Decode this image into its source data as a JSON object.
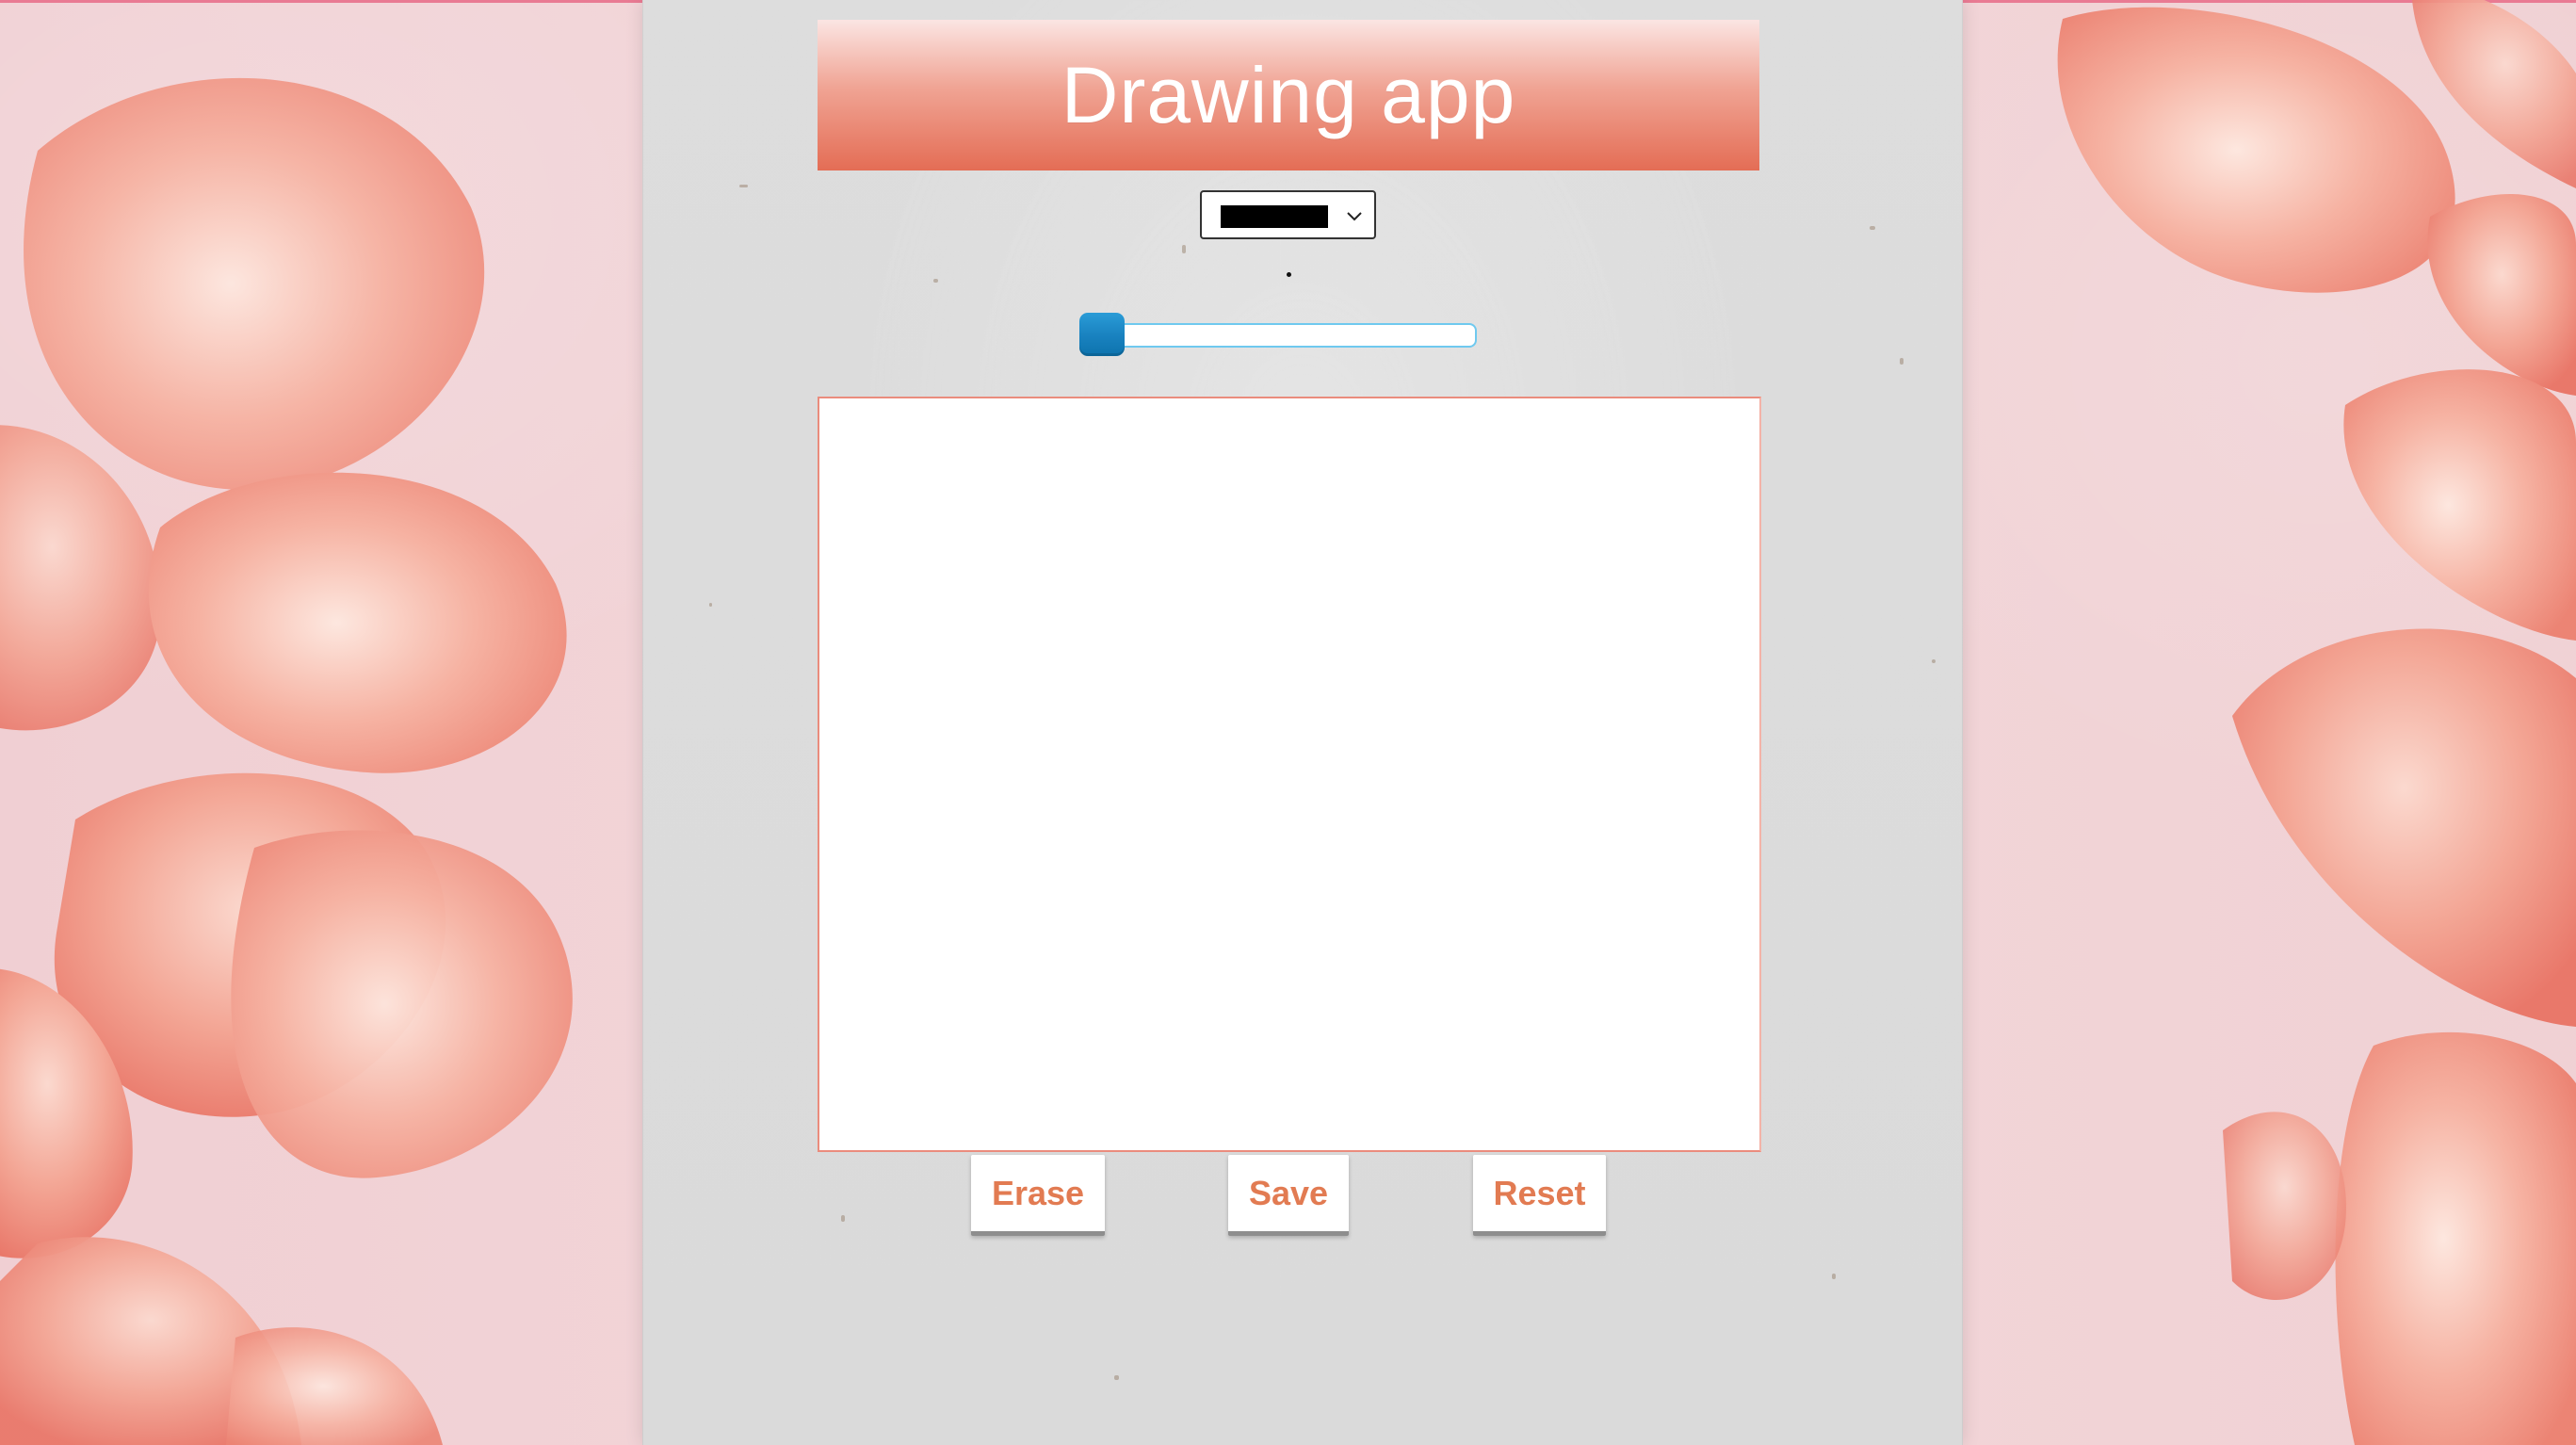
{
  "app": {
    "title": "Drawing app"
  },
  "toolbar": {
    "selected_color": "#000000",
    "brush_size_percent": 0
  },
  "buttons": {
    "erase_label": "Erase",
    "save_label": "Save",
    "reset_label": "Reset"
  },
  "theme": {
    "header_gradient_top": "#fbe5e3",
    "header_gradient_bottom": "#e46d55",
    "button_text_color": "#e27b52",
    "slider_color": "#1a83c1",
    "canvas_border_color": "#ea8c7d"
  }
}
